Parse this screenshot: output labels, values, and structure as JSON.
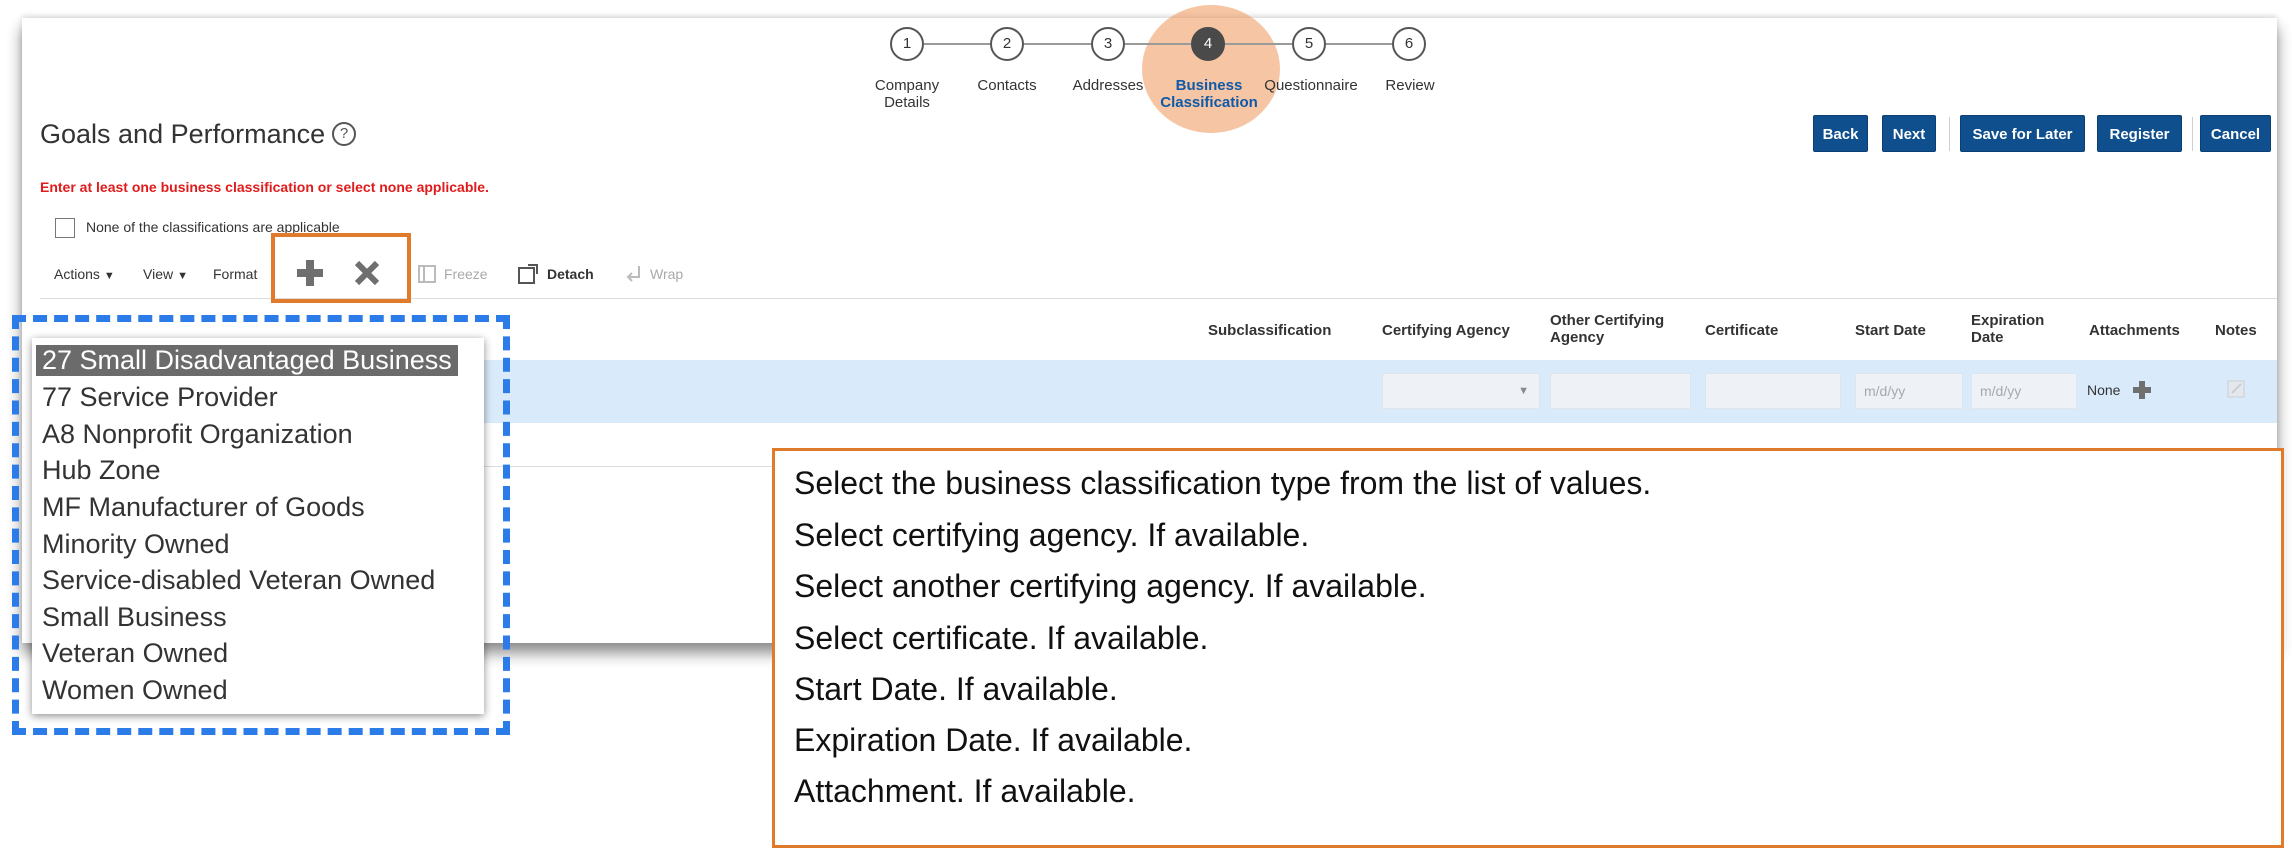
{
  "train": {
    "steps": [
      {
        "number": "1",
        "label_line1": "Company",
        "label_line2": "Details"
      },
      {
        "number": "2",
        "label_line1": "Contacts",
        "label_line2": ""
      },
      {
        "number": "3",
        "label_line1": "Addresses",
        "label_line2": ""
      },
      {
        "number": "4",
        "label_line1": "Business",
        "label_line2": "Classification"
      },
      {
        "number": "5",
        "label_line1": "Questionnaire",
        "label_line2": ""
      },
      {
        "number": "6",
        "label_line1": "Review",
        "label_line2": ""
      }
    ],
    "active_step": "4"
  },
  "header": {
    "title": "Goals and Performance",
    "help_glyph": "?"
  },
  "buttons": {
    "back": "Back",
    "next": "Next",
    "save_for_later": "Save for Later",
    "register": "Register",
    "cancel": "Cancel"
  },
  "error_message": "Enter at least one business classification or select none applicable.",
  "none_checkbox": {
    "label": "None of the classifications are applicable",
    "checked": false
  },
  "toolbar": {
    "actions": "Actions",
    "view": "View",
    "format": "Format",
    "freeze": "Freeze",
    "detach": "Detach",
    "wrap": "Wrap"
  },
  "table": {
    "columns": {
      "subclassification": "Subclassification",
      "certifying_agency": "Certifying Agency",
      "other_certifying_agency_1": "Other Certifying",
      "other_certifying_agency_2": "Agency",
      "certificate": "Certificate",
      "start_date": "Start Date",
      "expiration_date_1": "Expiration",
      "expiration_date_2": "Date",
      "attachments": "Attachments",
      "notes": "Notes"
    },
    "row": {
      "start_date_placeholder": "m/d/yy",
      "expiration_date_placeholder": "m/d/yy",
      "attachments_value": "None"
    }
  },
  "classification_dropdown": {
    "selected": "27 Small Disadvantaged Business",
    "options": [
      "27 Small Disadvantaged Business",
      "77 Service Provider",
      "A8 Nonprofit Organization",
      "Hub Zone",
      "MF Manufacturer of Goods",
      "Minority Owned",
      "Service-disabled Veteran Owned",
      "Small Business",
      "Veteran Owned",
      "Women Owned"
    ]
  },
  "instructions": [
    "Select the business classification type from the list of values.",
    "Select certifying agency. If available.",
    "Select another certifying agency. If available.",
    "Select certificate. If available.",
    "Start Date. If available.",
    "Expiration Date. If available.",
    "Attachment. If available."
  ],
  "colors": {
    "primary_button": "#0f4f8e",
    "error": "#e01b1b",
    "selected_row": "#d9ebfa",
    "annotation_orange": "#e07b2c",
    "annotation_blue": "#2b7be8"
  }
}
